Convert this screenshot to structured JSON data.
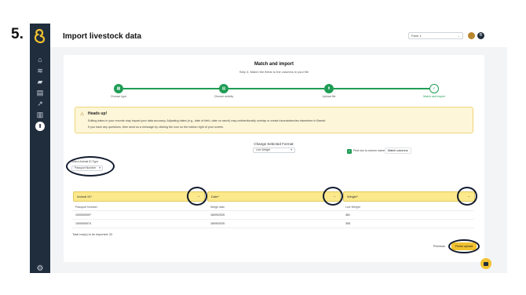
{
  "step_marker": "5.",
  "sidebar": {
    "items": [
      {
        "icon": "home-icon",
        "glyph": "⌂"
      },
      {
        "icon": "livestock-icon",
        "glyph": "≋"
      },
      {
        "icon": "cow-icon",
        "glyph": "▰"
      },
      {
        "icon": "feed-icon",
        "glyph": "▤"
      },
      {
        "icon": "chart-icon",
        "glyph": "↗"
      },
      {
        "icon": "clipboard-icon",
        "glyph": "▥"
      },
      {
        "icon": "upload-icon",
        "glyph": "⬆"
      }
    ],
    "settings_glyph": "⚙"
  },
  "header": {
    "title": "Import livestock data",
    "farm_select": "Farm 1",
    "chevron": "⌄",
    "avatar_initial": "B"
  },
  "card": {
    "title": "Match and import",
    "subtitle": "Step 4: Match the fields to the columns in your file"
  },
  "steps": [
    {
      "label": "Choose type",
      "glyph": "▦",
      "state": "done"
    },
    {
      "label": "Choose activity",
      "glyph": "▤",
      "state": "done"
    },
    {
      "label": "Upload file",
      "glyph": "⬆",
      "state": "done"
    },
    {
      "label": "Match and import",
      "glyph": "✓",
      "state": "current"
    }
  ],
  "alert": {
    "icon": "⚠",
    "title": "Heads up!",
    "line1": "Editing dates in your records may impact your data accuracy. Adjusting dates (e.g., date of birth, date on ranch) may unintentionally overlap or create inconsistencies elsewhere in Breedr.",
    "line2": "If you have any questions, then send us a message by clicking the icon on the bottom right of your screen."
  },
  "format": {
    "label": "Change Selected Format:",
    "value": "Live Weight",
    "chevron": "▾"
  },
  "id_type": {
    "label": "Select Animal ID Type",
    "value": "Passport Number",
    "chevron": "▾"
  },
  "options": {
    "check": "✓",
    "first_row_label": "First row is column names",
    "match_columns": "Match columns"
  },
  "columns": [
    {
      "field": "Animal ID*",
      "source": "Passport Number",
      "values": [
        "1000000097",
        "1000000074"
      ]
    },
    {
      "field": "Date*",
      "source": "Weigh date",
      "values": [
        "18/09/2025",
        "18/09/2025"
      ]
    },
    {
      "field": "Weight*",
      "source": "Live Weight",
      "values": [
        "481",
        "308"
      ]
    }
  ],
  "column_chevron": "⌄",
  "footer": {
    "total": "Total row(s) to be imported: 20",
    "previous": "Previous",
    "finish": "Finish upload"
  }
}
